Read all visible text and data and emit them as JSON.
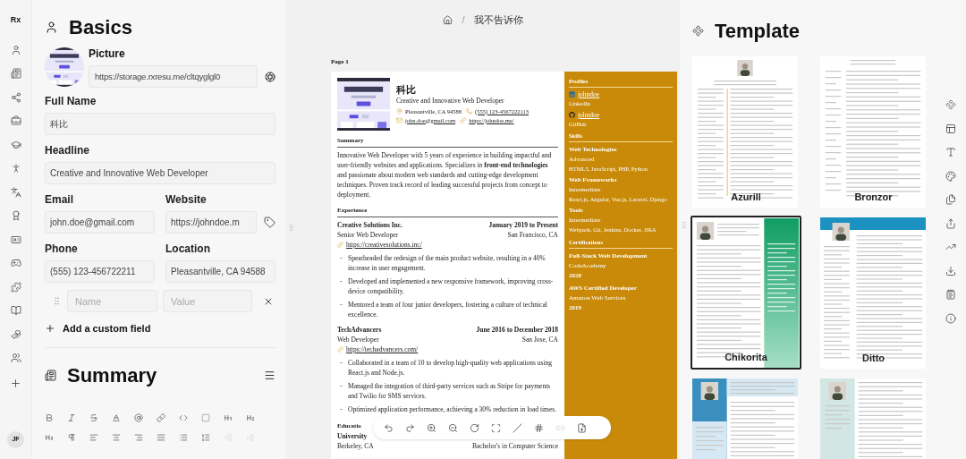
{
  "rail": {
    "logo": "Rx",
    "avatar": "JF"
  },
  "basics": {
    "title": "Basics",
    "picture_label": "Picture",
    "picture_url": "https://storage.rxresu.me/cltqyglgl0",
    "fields": [
      {
        "label": "Full Name",
        "value": "科比",
        "kind": "wide"
      },
      {
        "label": "Headline",
        "value": "Creative and Innovative Web Developer",
        "kind": "wide"
      },
      {
        "label": "Email",
        "value": "john.doe@gmail.com",
        "kind": "half"
      },
      {
        "label": "Website",
        "value": "https://johndoe.m",
        "kind": "half-tag"
      },
      {
        "label": "Phone",
        "value": "(555) 123-456722211",
        "kind": "half"
      },
      {
        "label": "Location",
        "value": "Pleasantville, CA 94588",
        "kind": "half"
      }
    ],
    "custom_field": {
      "name_placeholder": "Name",
      "value_placeholder": "Value"
    },
    "add_button": "Add a custom field"
  },
  "summary": {
    "title": "Summary",
    "toolbar": {
      "outdent_disabled": true,
      "indent_disabled": true
    }
  },
  "breadcrumb": {
    "separator": "/",
    "current": "我不告诉你"
  },
  "resume": {
    "page_label": "Page 1",
    "name": "科比",
    "headline": "Creative and Innovative Web Developer",
    "contacts": [
      {
        "kind": "location",
        "text": "Pleasantville, CA 94588"
      },
      {
        "kind": "phone",
        "text": "(555) 123-4567222113"
      },
      {
        "kind": "email",
        "text": "john.doe@gmail.com"
      },
      {
        "kind": "website",
        "text": "https://johndoe.me/"
      }
    ],
    "summary": {
      "title": "Summary",
      "text": "Innovative Web Developer with 5 years of experience in building impactful and user-friendly websites and applications. Specializes in **front-end technologies** and passionate about modern web standards and cutting-edge development techniques. Proven track record of leading successful projects from concept to deployment."
    },
    "experience": {
      "title": "Experience",
      "items": [
        {
          "company": "Creative Solutions Inc.",
          "date": "January 2019 to Present",
          "position": "Senior Web Developer",
          "location": "San Francisco, CA",
          "url": "https://creativesolutions.inc/",
          "bullets": [
            "Spearheaded the redesign of the main product website, resulting in a 40% increase in user engagement.",
            "Developed and implemented a new responsive framework, improving cross-device compatibility.",
            "Mentored a team of four junior developers, fostering a culture of technical excellence."
          ]
        },
        {
          "company": "TechAdvancers",
          "date": "June 2016 to December 2018",
          "position": "Web Developer",
          "location": "San Jose, CA",
          "url": "https://techadvancers.com/",
          "bullets": [
            "Collaborated in a team of 10 to develop high-quality web applications using React.js and Node.js.",
            "Managed the integration of third-party services such as Stripe for payments and Twilio for SMS services.",
            "Optimized application performance, achieving a 30% reduction in load times."
          ]
        }
      ]
    },
    "education": {
      "title": "Educatio",
      "institution": "University",
      "location": "Berkeley, CA",
      "degree": "Bachelor's in Computer Science"
    },
    "sidebar": {
      "profiles": {
        "title": "Profiles",
        "items": [
          {
            "kind": "linkedin",
            "username": "johndoe",
            "network": "LinkedIn"
          },
          {
            "kind": "github",
            "username": "johndoe",
            "network": "GitHub"
          }
        ]
      },
      "skills": {
        "title": "Skills",
        "items": [
          {
            "name": "Web Technologies",
            "level": "Advanced",
            "keywords": "HTML5, JavaScript, PHP, Python"
          },
          {
            "name": "Web Frameworks",
            "level": "Intermediate",
            "keywords": "React.js, Angular, Vue.js, Laravel, Django"
          },
          {
            "name": "Tools",
            "level": "Intermediate",
            "keywords": "Webpack, Git, Jenkins, Docker, JIRA"
          }
        ]
      },
      "certifications": {
        "title": "Certifications",
        "items": [
          {
            "name": "Full-Stack Web Development",
            "issuer": "CodeAcademy",
            "date": "2020"
          },
          {
            "name": "AWS Certified Developer",
            "issuer": "Amazon Web Services",
            "date": "2019"
          }
        ]
      }
    }
  },
  "page_toolbar": {
    "link_disabled": true
  },
  "template": {
    "title": "Template",
    "items": [
      {
        "kind": "azurill",
        "name": "Azurill",
        "selected": false
      },
      {
        "kind": "bronzor",
        "name": "Bronzor",
        "selected": false
      },
      {
        "kind": "chikorita",
        "name": "Chikorita",
        "selected": true
      },
      {
        "kind": "ditto",
        "name": "Ditto",
        "selected": false
      },
      {
        "kind": "gengar",
        "selected": false
      },
      {
        "kind": "glalie",
        "selected": false
      }
    ]
  }
}
